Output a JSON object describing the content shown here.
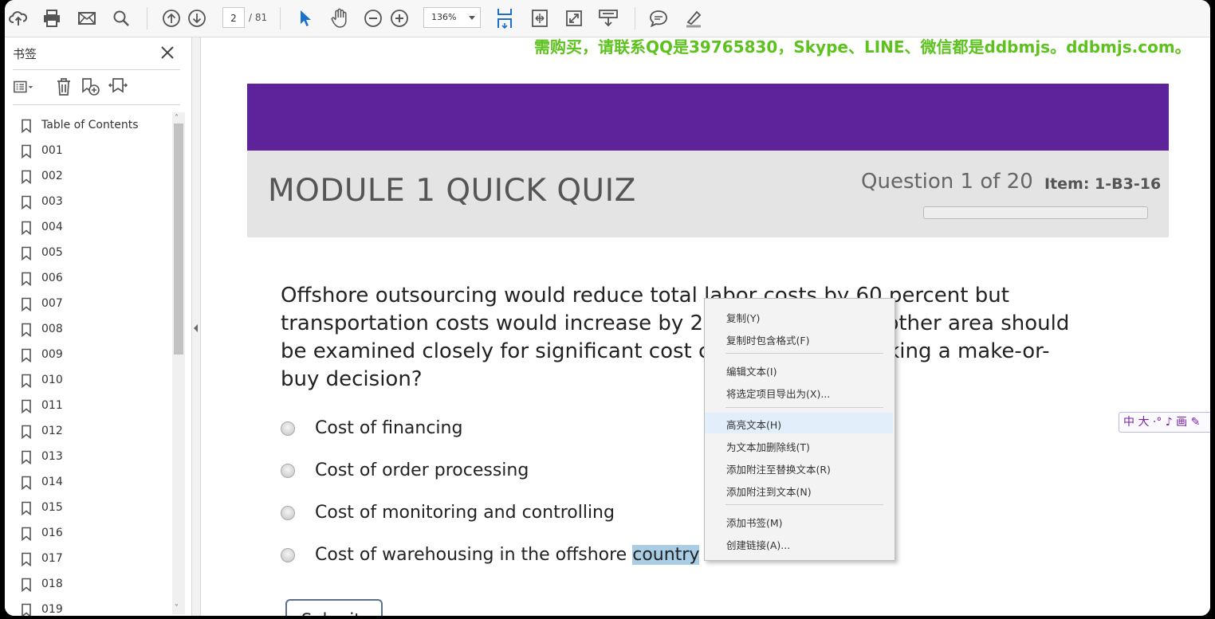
{
  "toolbar": {
    "current_page": "2",
    "page_total": "/ 81",
    "zoom": "136%"
  },
  "sidebar": {
    "title": "书签",
    "bookmarks": [
      "Table of Contents",
      "001",
      "002",
      "003",
      "004",
      "005",
      "006",
      "007",
      "008",
      "009",
      "010",
      "011",
      "012",
      "013",
      "014",
      "015",
      "016",
      "017",
      "018",
      "019"
    ]
  },
  "doc": {
    "watermark": "需购买，请联系QQ是39765830，Skype、LINE、微信都是ddbmjs。ddbmjs.com。",
    "quiz_title": "MODULE 1 QUICK QUIZ",
    "question_count": "Question 1 of 20",
    "item_label": "Item: 1-B3-16",
    "question": "Offshore outsourcing would reduce total labor costs by 60 percent but transportation costs would increase by 20 percent. Which other area should be examined closely for significant cost changes when making a make-or-buy decision?",
    "answers": [
      "Cost of financing",
      "Cost of order processing",
      "Cost of monitoring and controlling"
    ],
    "answer4_prefix": "Cost of warehousing in the offshore ",
    "answer4_selected": "country",
    "submit_label": "Submit",
    "ime_text": "中 大 ·° ♪ 画 ✎"
  },
  "context_menu": {
    "items": [
      "复制(Y)",
      "复制时包含格式(F)",
      "编辑文本(I)",
      "将选定项目导出为(X)...",
      "高亮文本(H)",
      "为文本加删除线(T)",
      "添加附注至替换文本(R)",
      "添加附注到文本(N)",
      "添加书签(M)",
      "创建链接(A)..."
    ],
    "highlighted_index": 4
  },
  "colors": {
    "quiz_header": "#5e239b",
    "watermark": "#5dc21e",
    "selection": "#a8cde4",
    "toolbar_accent": "#1d6fce"
  }
}
